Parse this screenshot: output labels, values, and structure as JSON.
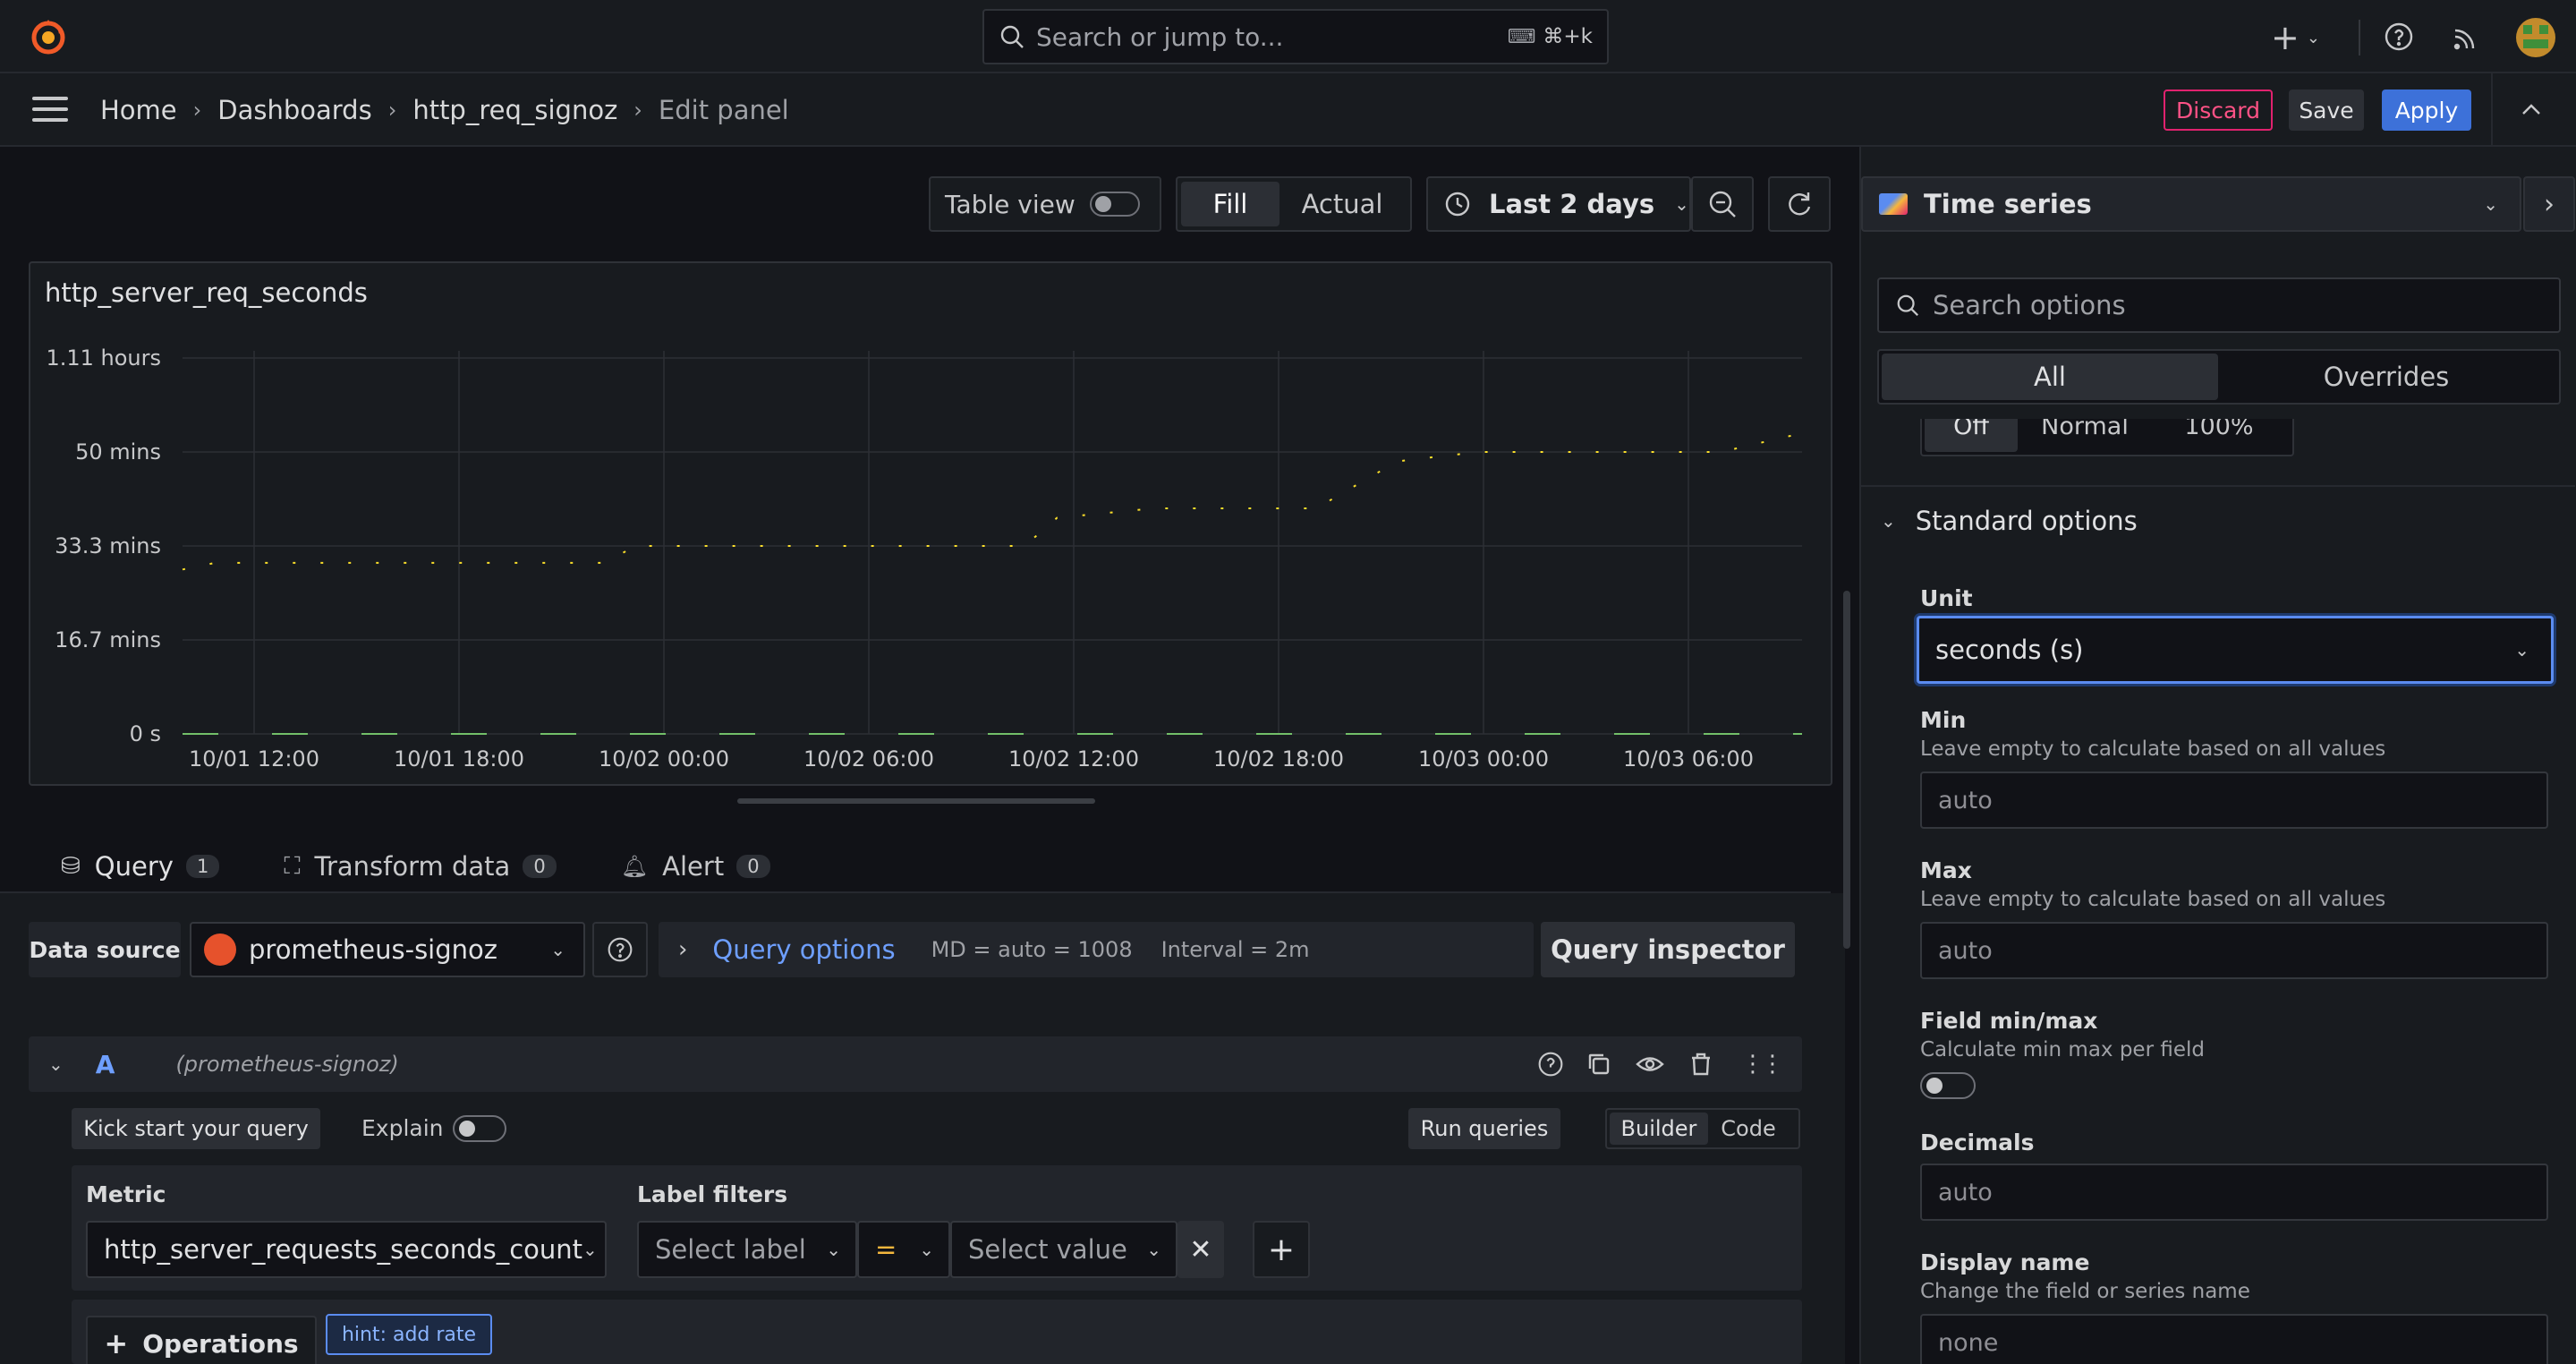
{
  "topbar": {
    "search_placeholder": "Search or jump to...",
    "shortcut": "⌘+k"
  },
  "breadcrumb": [
    "Home",
    "Dashboards",
    "http_req_signoz",
    "Edit panel"
  ],
  "actions": {
    "discard": "Discard",
    "save": "Save",
    "apply": "Apply"
  },
  "toolbar": {
    "table_view": "Table view",
    "fill": "Fill",
    "actual": "Actual",
    "time_range": "Last 2 days"
  },
  "viz": {
    "type": "Time series"
  },
  "panel": {
    "title": "http_server_req_seconds"
  },
  "chart_data": {
    "type": "line",
    "title": "http_server_req_seconds",
    "y_ticks": [
      "1.11 hours",
      "50 mins",
      "33.3 mins",
      "16.7 mins",
      "0 s"
    ],
    "x_ticks": [
      "10/01 12:00",
      "10/01 18:00",
      "10/02 00:00",
      "10/02 06:00",
      "10/02 12:00",
      "10/02 18:00",
      "10/03 00:00",
      "10/03 06:00"
    ],
    "ylim_seconds": [
      0,
      4000
    ],
    "series": [
      {
        "color": "#fade2a",
        "points": [
          [
            0.0,
            1750
          ],
          [
            0.02,
            1820
          ],
          [
            0.26,
            1820
          ],
          [
            0.28,
            2000
          ],
          [
            0.52,
            2000
          ],
          [
            0.54,
            2300
          ],
          [
            0.6,
            2400
          ],
          [
            0.7,
            2400
          ],
          [
            0.75,
            2900
          ],
          [
            0.8,
            3000
          ],
          [
            0.95,
            3000
          ],
          [
            1.0,
            3200
          ]
        ]
      },
      {
        "color": "#73bf69",
        "points": [
          [
            0.0,
            0
          ],
          [
            1.0,
            0
          ]
        ]
      }
    ],
    "grid": true,
    "legend": "none"
  },
  "tabs": [
    {
      "label": "Query",
      "count": "1"
    },
    {
      "label": "Transform data",
      "count": "0"
    },
    {
      "label": "Alert",
      "count": "0"
    }
  ],
  "datasource": {
    "label": "Data source",
    "name": "prometheus-signoz",
    "query_options": "Query options",
    "md": "MD = auto = 1008",
    "interval": "Interval = 2m",
    "inspector": "Query inspector"
  },
  "query": {
    "ref": "A",
    "ds": "(prometheus-signoz)",
    "kick": "Kick start your query",
    "explain": "Explain",
    "run": "Run queries",
    "builder": "Builder",
    "code": "Code",
    "metric_label": "Metric",
    "metric_value": "http_server_requests_seconds_count",
    "label_filters": "Label filters",
    "select_label": "Select label",
    "op": "=",
    "select_value": "Select value",
    "operations": "Operations",
    "hint": "hint: add rate"
  },
  "options": {
    "search_placeholder": "Search options",
    "all": "All",
    "overrides": "Overrides",
    "stack": [
      "Off",
      "Normal",
      "100%"
    ],
    "section": "Standard options",
    "unit_label": "Unit",
    "unit_value": "seconds (s)",
    "min_label": "Min",
    "min_desc": "Leave empty to calculate based on all values",
    "min_placeholder": "auto",
    "max_label": "Max",
    "max_desc": "Leave empty to calculate based on all values",
    "max_placeholder": "auto",
    "fieldminmax_label": "Field min/max",
    "fieldminmax_desc": "Calculate min max per field",
    "decimals_label": "Decimals",
    "decimals_placeholder": "auto",
    "display_label": "Display name",
    "display_desc": "Change the field or series name",
    "display_placeholder": "none"
  }
}
